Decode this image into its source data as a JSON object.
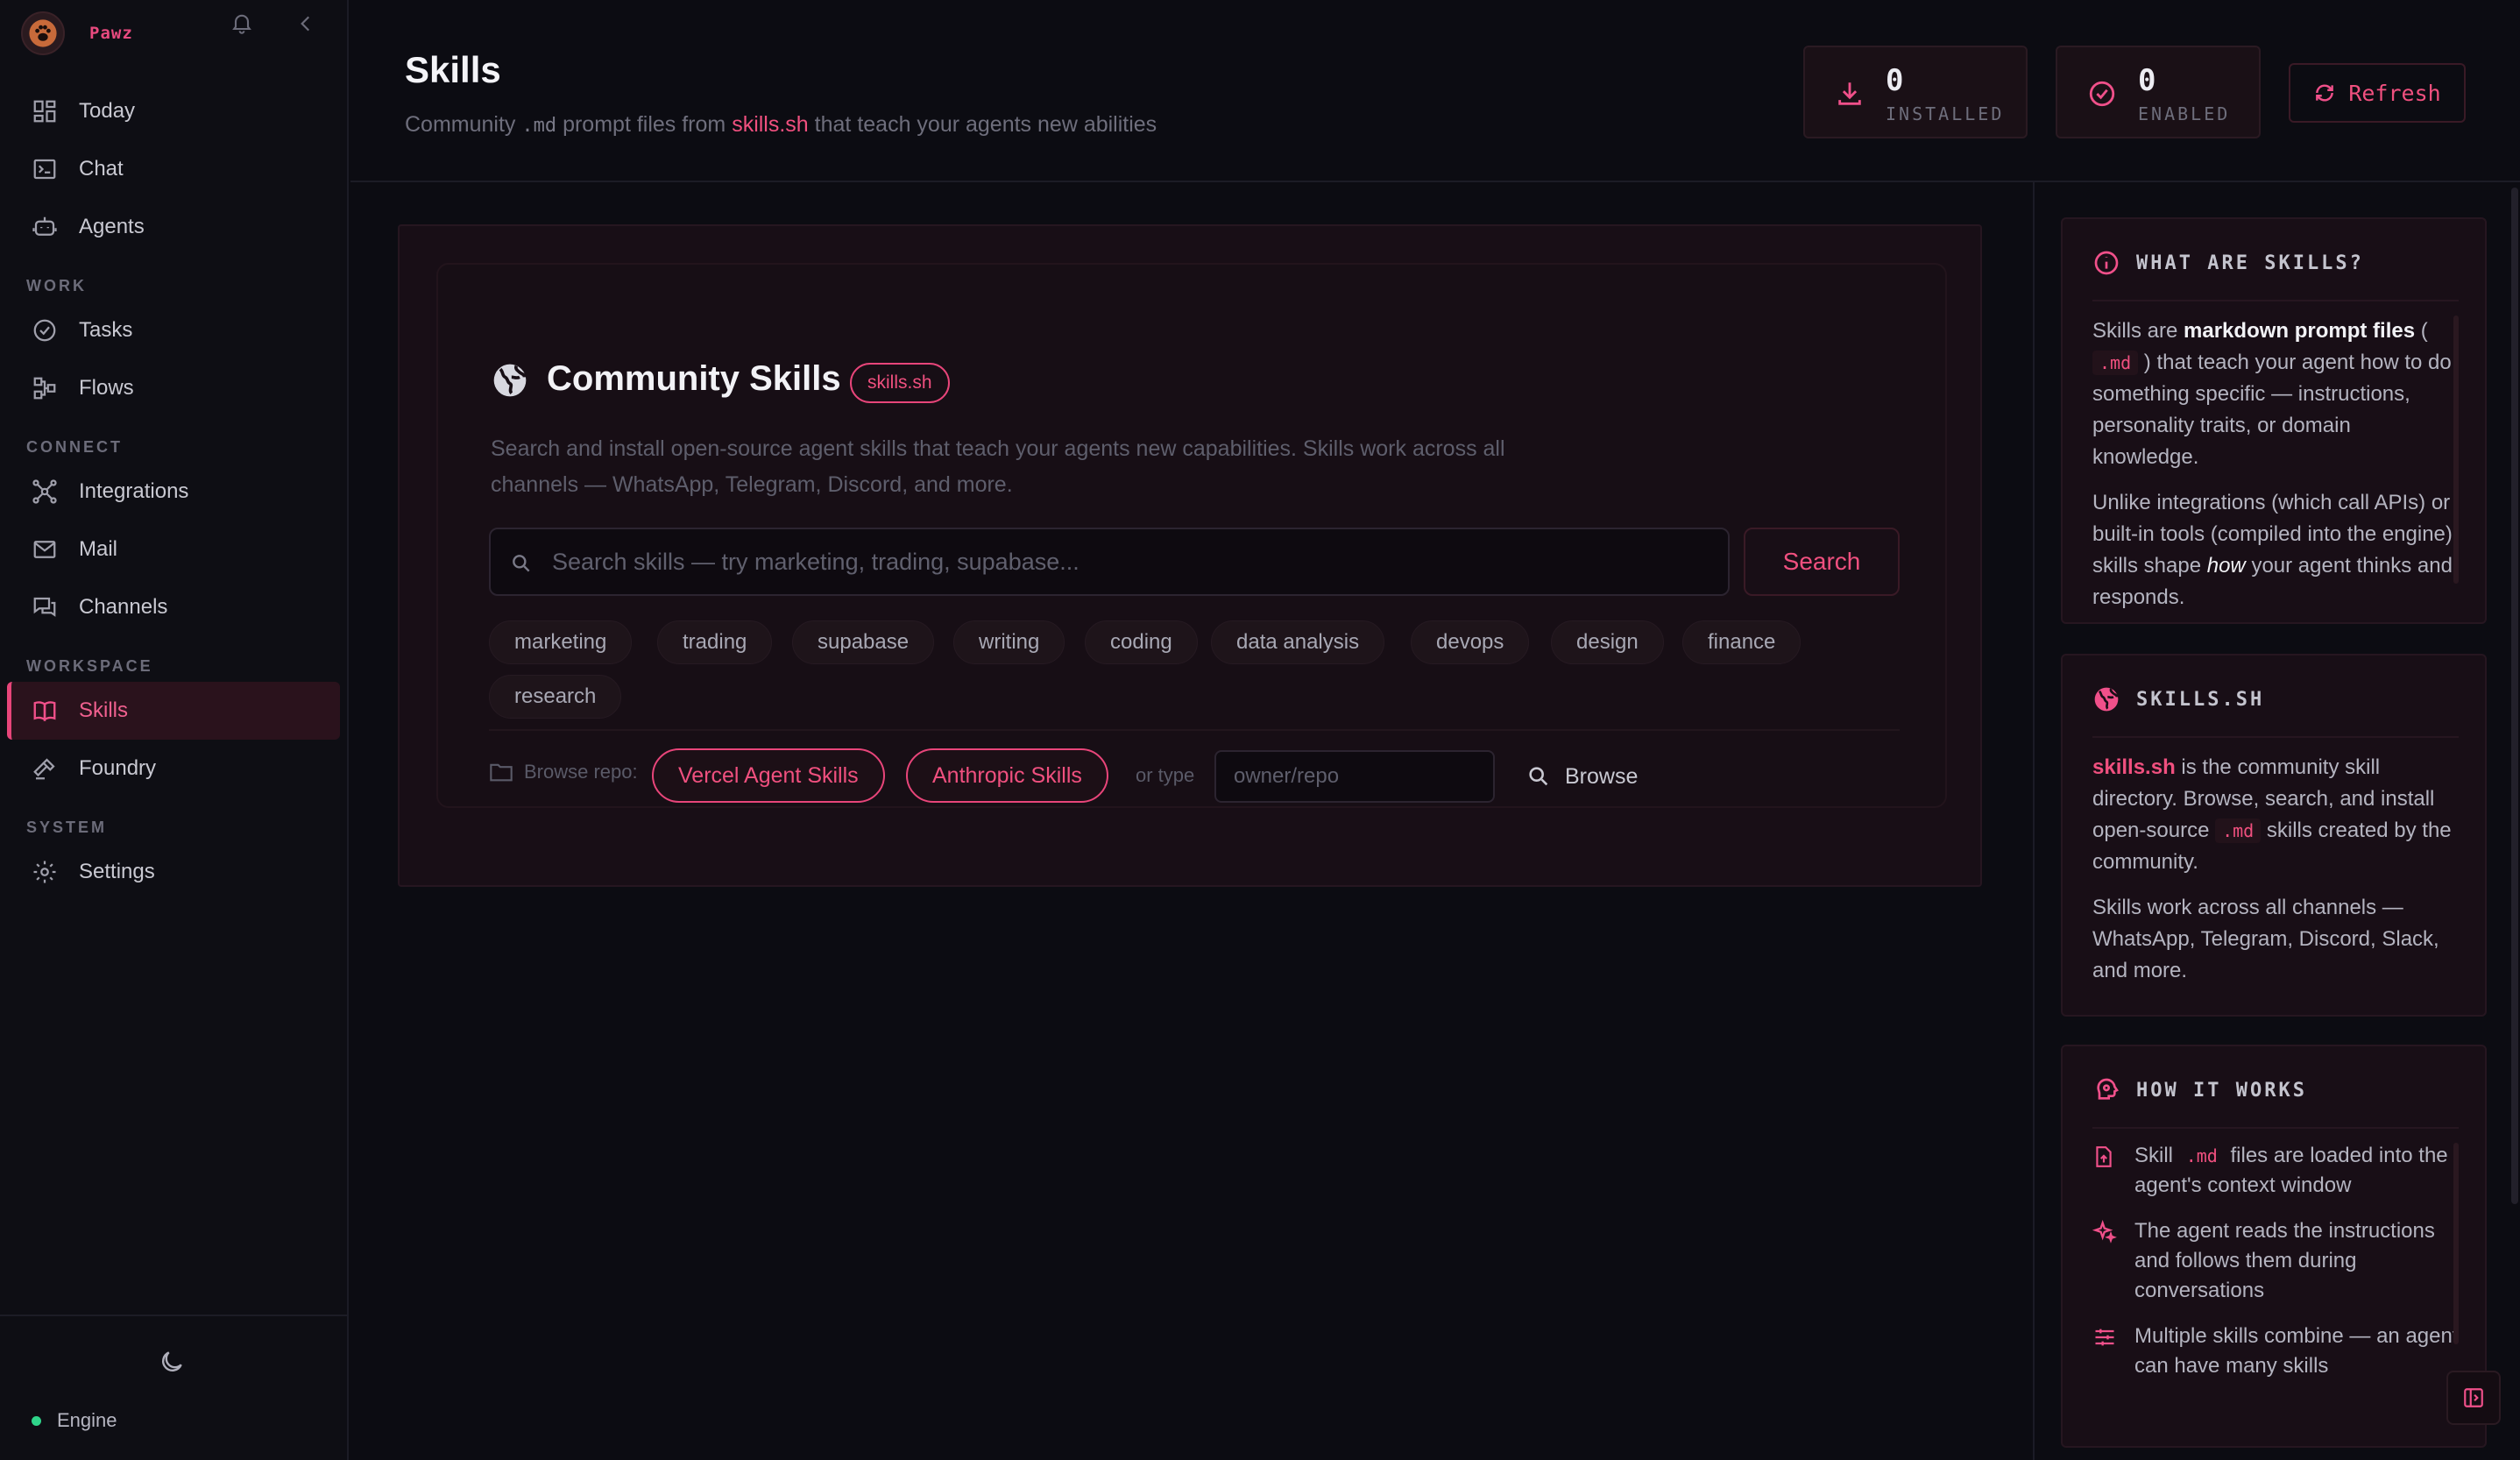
{
  "app": {
    "name": "Pawz"
  },
  "colors": {
    "accent": "#e8457a",
    "accent_text": "#f0507f",
    "background": "#0c0c12",
    "engine_status": "#2fd48a"
  },
  "sidebar": {
    "items_top": [
      {
        "label": "Today",
        "icon": "dashboard-icon"
      },
      {
        "label": "Chat",
        "icon": "terminal-icon"
      },
      {
        "label": "Agents",
        "icon": "robot-icon"
      }
    ],
    "sections": [
      {
        "label": "WORK",
        "items": [
          {
            "label": "Tasks",
            "icon": "check-circle-icon"
          },
          {
            "label": "Flows",
            "icon": "flow-icon"
          }
        ]
      },
      {
        "label": "CONNECT",
        "items": [
          {
            "label": "Integrations",
            "icon": "network-icon"
          },
          {
            "label": "Mail",
            "icon": "mail-icon"
          },
          {
            "label": "Channels",
            "icon": "chat-bubbles-icon"
          }
        ]
      },
      {
        "label": "WORKSPACE",
        "items": [
          {
            "label": "Skills",
            "icon": "book-icon",
            "active": true
          },
          {
            "label": "Foundry",
            "icon": "hammer-icon"
          }
        ]
      },
      {
        "label": "SYSTEM",
        "items": [
          {
            "label": "Settings",
            "icon": "gear-icon"
          }
        ]
      }
    ],
    "engine_label": "Engine"
  },
  "header": {
    "title": "Skills",
    "subtitle_pre": "Community",
    "subtitle_code": ".md",
    "subtitle_mid": "prompt files from",
    "subtitle_link": "skills.sh",
    "subtitle_post": "that teach your agents new abilities",
    "stats": [
      {
        "value": "0",
        "label": "INSTALLED",
        "icon": "download-icon"
      },
      {
        "value": "0",
        "label": "ENABLED",
        "icon": "check-circle-icon"
      }
    ],
    "refresh_label": "Refresh"
  },
  "community": {
    "title": "Community Skills",
    "badge": "skills.sh",
    "description": "Search and install open-source agent skills that teach your agents new capabilities. Skills work across all channels — WhatsApp, Telegram, Discord, and more.",
    "search_placeholder": "Search skills — try marketing, trading, supabase...",
    "search_button": "Search",
    "tags": [
      "marketing",
      "trading",
      "supabase",
      "writing",
      "coding",
      "data analysis",
      "devops",
      "design",
      "finance",
      "research"
    ],
    "browse_label": "Browse repo:",
    "repos": [
      "Vercel Agent Skills",
      "Anthropic Skills"
    ],
    "or_type": "or type",
    "repo_placeholder": "owner/repo",
    "browse_button": "Browse"
  },
  "panels": {
    "what": {
      "title": "WHAT ARE SKILLS?",
      "p1_a": "Skills are",
      "p1_b": "markdown prompt files",
      "p1_c": "(",
      "p1_code": ".md",
      "p1_d": ") that teach your agent how to do something specific — instructions, personality traits, or domain knowledge.",
      "p2_a": "Unlike integrations (which call APIs) or built-in tools (compiled into the engine), skills shape",
      "p2_em": "how",
      "p2_b": "your agent thinks and responds."
    },
    "skillssh": {
      "title": "SKILLS.SH",
      "p1_link": "skills.sh",
      "p1_a": "is the community skill directory. Browse, search, and install open-source",
      "p1_code": ".md",
      "p1_b": "skills created by the community.",
      "p2": "Skills work across all channels — WhatsApp, Telegram, Discord, Slack, and more."
    },
    "how": {
      "title": "HOW IT WORKS",
      "items": [
        {
          "pre": "Skill",
          "code": ".md",
          "post": "files are loaded into the agent's context window"
        },
        {
          "text": "The agent reads the instructions and follows them during conversations"
        },
        {
          "text": "Multiple skills combine — an agent can have many skills"
        }
      ]
    }
  }
}
